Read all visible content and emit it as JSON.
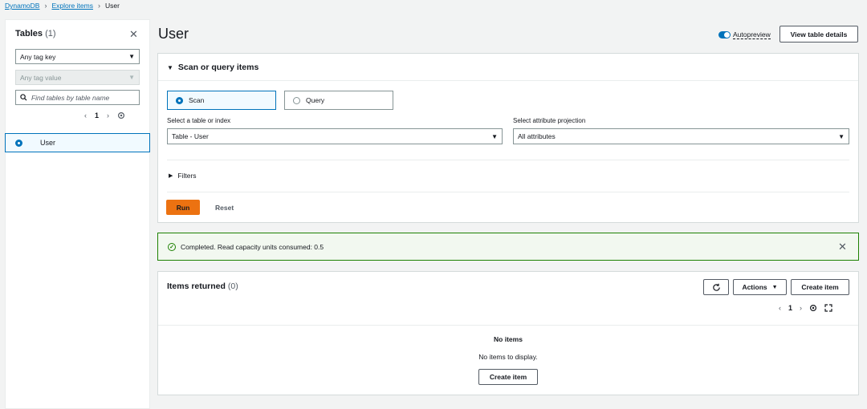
{
  "breadcrumb": {
    "items": [
      "DynamoDB",
      "Explore items"
    ],
    "current": "User"
  },
  "sidebar": {
    "title": "Tables",
    "count": "(1)",
    "tag_key": "Any tag key",
    "tag_value": "Any tag value",
    "search_placeholder": "Find tables by table name",
    "page": "1",
    "tables": [
      {
        "name": "User",
        "selected": true
      }
    ]
  },
  "header": {
    "title": "User",
    "autopreview_label": "Autopreview",
    "autopreview_on": true,
    "view_details_label": "View table details"
  },
  "scan": {
    "section_title": "Scan or query items",
    "mode_scan": "Scan",
    "mode_query": "Query",
    "selected_mode": "Scan",
    "table_label": "Select a table or index",
    "table_value": "Table - User",
    "projection_label": "Select attribute projection",
    "projection_value": "All attributes",
    "filters_label": "Filters",
    "run_label": "Run",
    "reset_label": "Reset"
  },
  "flash": {
    "message": "Completed. Read capacity units consumed: 0.5",
    "type": "success"
  },
  "items": {
    "title": "Items returned",
    "count": "(0)",
    "actions_label": "Actions",
    "create_label": "Create item",
    "page": "1",
    "empty_title": "No items",
    "empty_text": "No items to display.",
    "empty_create_label": "Create item"
  },
  "colors": {
    "accent": "#0073bb",
    "run_button": "#ec7211",
    "success": "#1d8102"
  }
}
